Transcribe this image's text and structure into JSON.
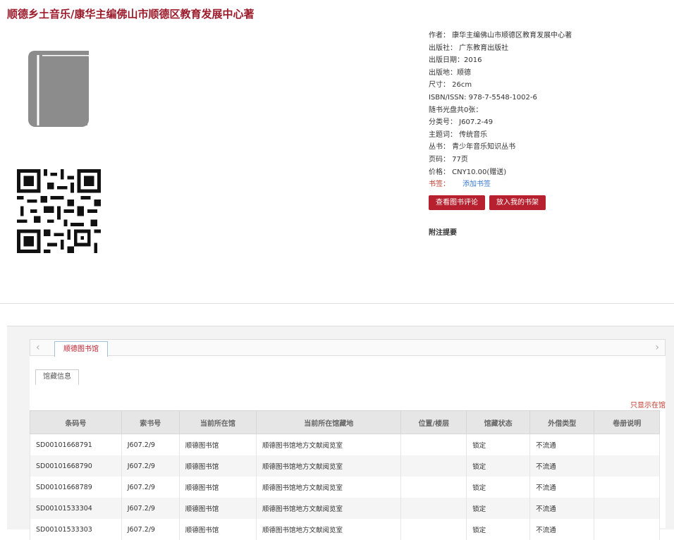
{
  "title": "顺德乡土音乐/康华主编佛山市顺德区教育发展中心著",
  "info": {
    "author": "作者：  康华主编佛山市顺德区教育发展中心著",
    "publisher": "出版社：  广东教育出版社",
    "date": "出版日期：2016",
    "place": "出版地：顺德",
    "size": "尺寸：  26cm",
    "isbn": "ISBN/ISSN:   978-7-5548-1002-6",
    "disc": "随书光盘共0张：",
    "class": "分类号：  J607.2-49",
    "subject": "主题词：  传统音乐",
    "series": "丛书：  青少年音乐知识丛书",
    "pages": "页码：  77页",
    "price": "价格：  CNY10.00(赠送)",
    "tag_label": "书签：",
    "tag_link": "添加书签"
  },
  "buttons": {
    "review": "查看图书评论",
    "shelf": "放入我的书架"
  },
  "notes_heading": "附注提要",
  "tabs": {
    "library": "顺德图书馆",
    "holding": "馆藏信息",
    "only_show": "只显示在馆"
  },
  "table": {
    "headers": [
      "条码号",
      "索书号",
      "当前所在馆",
      "当前所在馆藏地",
      "位置/楼层",
      "馆藏状态",
      "外借类型",
      "卷册说明"
    ],
    "rows": [
      [
        "SD00101668791",
        "J607.2/9",
        "顺德图书馆",
        "顺德图书馆地方文献阅览室",
        "",
        "锁定",
        "不流通",
        ""
      ],
      [
        "SD00101668790",
        "J607.2/9",
        "顺德图书馆",
        "顺德图书馆地方文献阅览室",
        "",
        "锁定",
        "不流通",
        ""
      ],
      [
        "SD00101668789",
        "J607.2/9",
        "顺德图书馆",
        "顺德图书馆地方文献阅览室",
        "",
        "锁定",
        "不流通",
        ""
      ],
      [
        "SD00101533304",
        "J607.2/9",
        "顺德图书馆",
        "顺德图书馆地方文献阅览室",
        "",
        "锁定",
        "不流通",
        ""
      ],
      [
        "SD00101533303",
        "J607.2/9",
        "顺德图书馆",
        "顺德图书馆地方文献阅览室",
        "",
        "锁定",
        "不流通",
        ""
      ]
    ]
  },
  "colors": {
    "accent": "#b7202e",
    "title": "#9b1b2b",
    "link": "#3a7bd5"
  },
  "icons": {
    "cover": "book-icon",
    "qr": "qr-code-icon",
    "prev": "chevron-left-icon",
    "next": "chevron-right-icon"
  }
}
